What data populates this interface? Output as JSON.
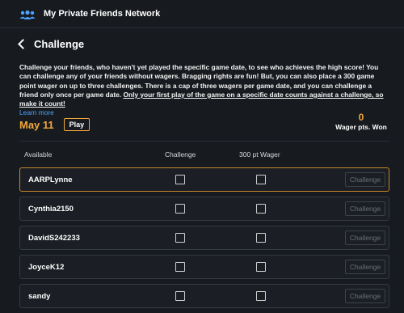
{
  "app": {
    "title": "My Private Friends Network"
  },
  "header": {
    "title": "Challenge"
  },
  "description": {
    "text": "Challenge your friends, who haven't yet played the specific game date, to see who achieves the high score! You can challenge any of your friends without wagers. Bragging rights are fun! But, you can also place a 300 game point wager on up to three challenges. There is a cap of three wagers per game date, and you can challenge a friend only once per game date.",
    "underlined": "Only your first play of the game on a specific date counts against a challenge, so make it count!",
    "learn_more": "Learn more"
  },
  "game": {
    "date": "May 11",
    "play_label": "Play"
  },
  "wager": {
    "value": "0",
    "label": "Wager pts. Won"
  },
  "columns": {
    "available": "Available",
    "challenge": "Challenge",
    "wager": "300 pt Wager"
  },
  "friends": [
    {
      "name": "AARPLynne",
      "button": "Challenge"
    },
    {
      "name": "Cynthia2150",
      "button": "Challenge"
    },
    {
      "name": "DavidS242233",
      "button": "Challenge"
    },
    {
      "name": "JoyceK12",
      "button": "Challenge"
    },
    {
      "name": "sandy",
      "button": "Challenge"
    }
  ],
  "colors": {
    "accent": "#f2a73b",
    "link": "#4da3ff",
    "background": "#171a1f"
  }
}
